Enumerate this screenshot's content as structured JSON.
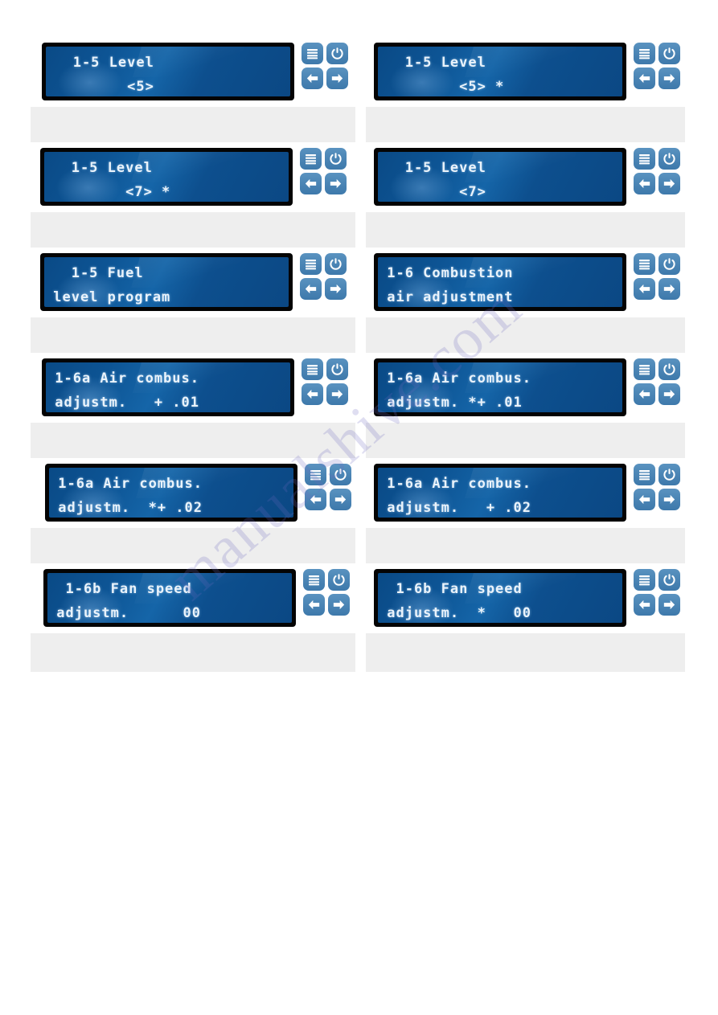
{
  "document": {
    "watermark_text": "manualshive.com",
    "background_color": "#ffffff",
    "panel_background_color": "#eeeeee",
    "card_background_color": "#ffffff",
    "lcd_bezel_color": "#040404",
    "lcd_screen_color": "#0d5494",
    "lcd_text_color": "#eaf3fb",
    "key_color": "#4c86b6"
  },
  "keypad": {
    "menu_button": {
      "name": "menu-button",
      "icon": "menu-icon",
      "label": "Menu"
    },
    "power_button": {
      "name": "power-button",
      "icon": "power-icon",
      "label": "Power"
    },
    "left_button": {
      "name": "left-arrow-button",
      "icon": "arrow-left-icon",
      "label": "Left"
    },
    "right_button": {
      "name": "right-arrow-button",
      "icon": "arrow-right-icon",
      "label": "Right"
    }
  },
  "columns": {
    "left": {
      "name": "left-column",
      "panels": [
        {
          "id": "L1",
          "line1": "   1-5 Level",
          "line2": "         <5>",
          "cursor_marker": false
        },
        {
          "id": "L2",
          "line1": "   1-5 Level",
          "line2": "         <7> *",
          "cursor_marker": true
        },
        {
          "id": "L3",
          "line1": "   1-5 Fuel",
          "line2": " level program",
          "cursor_marker": false
        },
        {
          "id": "L4",
          "line1": " 1-6a Air combus.",
          "line2": " adjustm.   + .01",
          "cursor_marker": false
        },
        {
          "id": "L5",
          "line1": " 1-6a Air combus.",
          "line2": " adjustm.  *+ .02",
          "cursor_marker": true
        },
        {
          "id": "L6",
          "line1": "  1-6b Fan speed",
          "line2": " adjustm.      00",
          "cursor_marker": false
        }
      ]
    },
    "right": {
      "name": "right-column",
      "panels": [
        {
          "id": "R1",
          "line1": "   1-5 Level",
          "line2": "         <5> *",
          "cursor_marker": true
        },
        {
          "id": "R2",
          "line1": "   1-5 Level",
          "line2": "         <7>",
          "cursor_marker": false
        },
        {
          "id": "R3",
          "line1": " 1-6 Combustion",
          "line2": " air adjustment",
          "cursor_marker": false
        },
        {
          "id": "R4",
          "line1": " 1-6a Air combus.",
          "line2": " adjustm. *+ .01",
          "cursor_marker": true
        },
        {
          "id": "R5",
          "line1": " 1-6a Air combus.",
          "line2": " adjustm.   + .02",
          "cursor_marker": false
        },
        {
          "id": "R6",
          "line1": "  1-6b Fan speed",
          "line2": " adjustm.  *   00",
          "cursor_marker": true
        }
      ]
    }
  }
}
